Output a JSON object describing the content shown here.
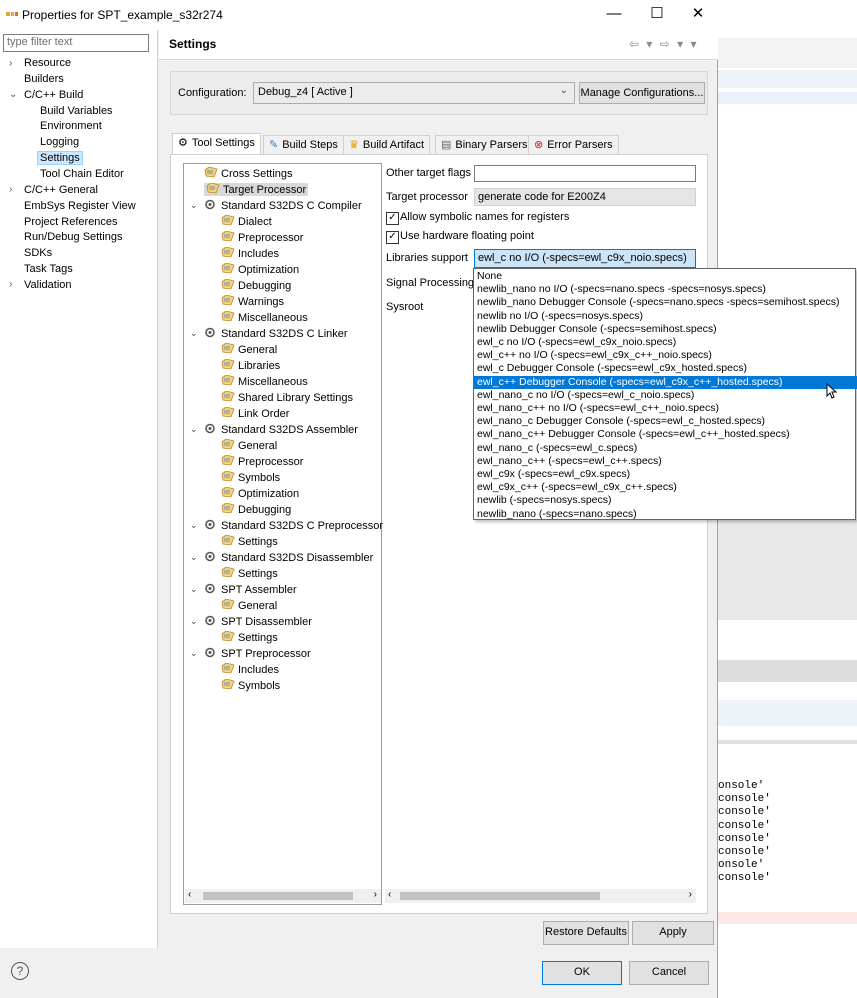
{
  "window": {
    "title": "Properties for SPT_example_s32r274",
    "minimize": "—",
    "maximize": "☐",
    "close": "✕"
  },
  "filter": {
    "placeholder": "type filter text"
  },
  "nav": [
    {
      "label": "Resource",
      "chev": "›"
    },
    {
      "label": "Builders"
    },
    {
      "label": "C/C++ Build",
      "chev": "⌄"
    },
    {
      "label": "Build Variables"
    },
    {
      "label": "Environment"
    },
    {
      "label": "Logging"
    },
    {
      "label": "Settings"
    },
    {
      "label": "Tool Chain Editor"
    },
    {
      "label": "C/C++ General",
      "chev": "›"
    },
    {
      "label": "EmbSys Register View"
    },
    {
      "label": "Project References"
    },
    {
      "label": "Run/Debug Settings"
    },
    {
      "label": "SDKs"
    },
    {
      "label": "Task Tags"
    },
    {
      "label": "Validation",
      "chev": "›"
    }
  ],
  "header": {
    "title": "Settings",
    "nav_arrows": "⇦ ▾ ⇨ ▾ ▾"
  },
  "config": {
    "label": "Configuration:",
    "value": "Debug_z4  [ Active ]",
    "manage": "Manage Configurations..."
  },
  "tabs": [
    "Tool Settings",
    "Build Steps",
    "Build Artifact",
    "Binary Parsers",
    "Error Parsers"
  ],
  "tree": [
    {
      "label": "Cross Settings"
    },
    {
      "label": "Target Processor"
    },
    {
      "label": "Standard S32DS C Compiler"
    },
    {
      "label": "Dialect"
    },
    {
      "label": "Preprocessor"
    },
    {
      "label": "Includes"
    },
    {
      "label": "Optimization"
    },
    {
      "label": "Debugging"
    },
    {
      "label": "Warnings"
    },
    {
      "label": "Miscellaneous"
    },
    {
      "label": "Standard S32DS C Linker"
    },
    {
      "label": "General"
    },
    {
      "label": "Libraries"
    },
    {
      "label": "Miscellaneous"
    },
    {
      "label": "Shared Library Settings"
    },
    {
      "label": "Link Order"
    },
    {
      "label": "Standard S32DS Assembler"
    },
    {
      "label": "General"
    },
    {
      "label": "Preprocessor"
    },
    {
      "label": "Symbols"
    },
    {
      "label": "Optimization"
    },
    {
      "label": "Debugging"
    },
    {
      "label": "Standard S32DS C Preprocessor"
    },
    {
      "label": "Settings"
    },
    {
      "label": "Standard S32DS Disassembler"
    },
    {
      "label": "Settings"
    },
    {
      "label": "SPT Assembler"
    },
    {
      "label": "General"
    },
    {
      "label": "SPT Disassembler"
    },
    {
      "label": "Settings"
    },
    {
      "label": "SPT Preprocessor"
    },
    {
      "label": "Includes"
    },
    {
      "label": "Symbols"
    }
  ],
  "props": {
    "other_flags_label": "Other target flags",
    "other_flags_value": "",
    "target_proc_label": "Target processor",
    "target_proc_value": "generate code for E200Z4",
    "allow_symbolic": "Allow symbolic names for registers",
    "use_hw_fp": "Use hardware floating point",
    "libraries_label": "Libraries support",
    "libraries_value": "ewl_c no I/O (-specs=ewl_c9x_noio.specs)",
    "signal_label": "Signal Processing",
    "sysroot_label": "Sysroot",
    "check": "✓"
  },
  "dropdown": [
    "None",
    "newlib_nano no I/O (-specs=nano.specs -specs=nosys.specs)",
    "newlib_nano Debugger Console (-specs=nano.specs -specs=semihost.specs)",
    "newlib no I/O (-specs=nosys.specs)",
    "newlib Debugger Console (-specs=semihost.specs)",
    "ewl_c no I/O (-specs=ewl_c9x_noio.specs)",
    "ewl_c++ no I/O (-specs=ewl_c9x_c++_noio.specs)",
    "ewl_c Debugger Console (-specs=ewl_c9x_hosted.specs)",
    "ewl_c++ Debugger Console (-specs=ewl_c9x_c++_hosted.specs)",
    "ewl_nano_c no I/O (-specs=ewl_c_noio.specs)",
    "ewl_nano_c++ no I/O (-specs=ewl_c++_noio.specs)",
    "ewl_nano_c Debugger Console (-specs=ewl_c_hosted.specs)",
    "ewl_nano_c++ Debugger Console (-specs=ewl_c++_hosted.specs)",
    "ewl_nano_c (-specs=ewl_c.specs)",
    "ewl_nano_c++ (-specs=ewl_c++.specs)",
    "ewl_c9x (-specs=ewl_c9x.specs)",
    "ewl_c9x_c++ (-specs=ewl_c9x_c++.specs)",
    "newlib (-specs=nosys.specs)",
    "newlib_nano (-specs=nano.specs)"
  ],
  "dropdown_selected": 8,
  "buttons": {
    "restore": "Restore Defaults",
    "apply": "Apply",
    "ok": "OK",
    "cancel": "Cancel",
    "help": "?"
  },
  "background_code": [
    "onsole'",
    "console'",
    "console'",
    "console'",
    "console'",
    "console'",
    "onsole'",
    "console'"
  ],
  "colors": {
    "accent": "#0078d7",
    "selection": "#cce8ff"
  }
}
